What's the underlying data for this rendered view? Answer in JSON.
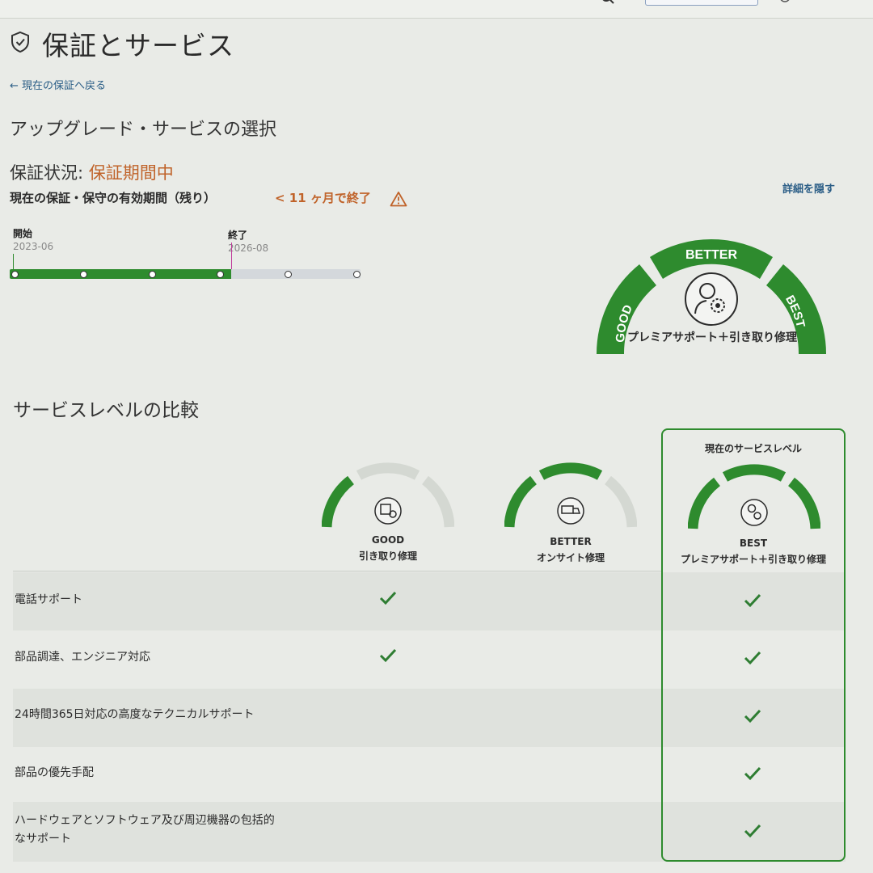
{
  "page": {
    "title": "保証とサービス",
    "back_link": "← 現在の保証へ戻る"
  },
  "upgrade": {
    "title": "アップグレード・サービスの選択"
  },
  "warranty": {
    "status_label": "保証状況: ",
    "status_value": "保証期間中",
    "period_label": "現在の保証・保守の有効期間（残り）",
    "remaining": "< 11 ヶ月で終了",
    "hide_details": "詳細を隠す",
    "timeline": {
      "start_label": "開始",
      "start_date": "2023-06",
      "end_label": "終了",
      "end_date": "2026-08"
    }
  },
  "gauge_big": {
    "good": "GOOD",
    "better": "BETTER",
    "best": "BEST",
    "label": "プレミアサポート＋引き取り修理"
  },
  "compare": {
    "title": "サービスレベルの比較",
    "current_label": "現在のサービスレベル",
    "columns": [
      {
        "level": "GOOD",
        "name": "引き取り修理",
        "icon": "package-repair-icon"
      },
      {
        "level": "BETTER",
        "name": "オンサイト修理",
        "icon": "onsite-truck-icon"
      },
      {
        "level": "BEST",
        "name": "プレミアサポート＋引き取り修理",
        "icon": "premium-support-icon"
      }
    ],
    "rows": [
      {
        "label": "電話サポート",
        "good": true,
        "better": false,
        "best": true
      },
      {
        "label": "部品調達、エンジニア対応",
        "good": true,
        "better": false,
        "best": true
      },
      {
        "label": "24時間365日対応の高度なテクニカルサポート",
        "good": false,
        "better": false,
        "best": true
      },
      {
        "label": "部品の優先手配",
        "good": false,
        "better": false,
        "best": true
      },
      {
        "label": "ハードウェアとソフトウェア及び周辺機器の包括的なサポート",
        "good": false,
        "better": false,
        "best": true
      }
    ]
  },
  "colors": {
    "accent_green": "#2e8b2e",
    "warning_orange": "#c0632a",
    "link_blue": "#2a5d86"
  }
}
